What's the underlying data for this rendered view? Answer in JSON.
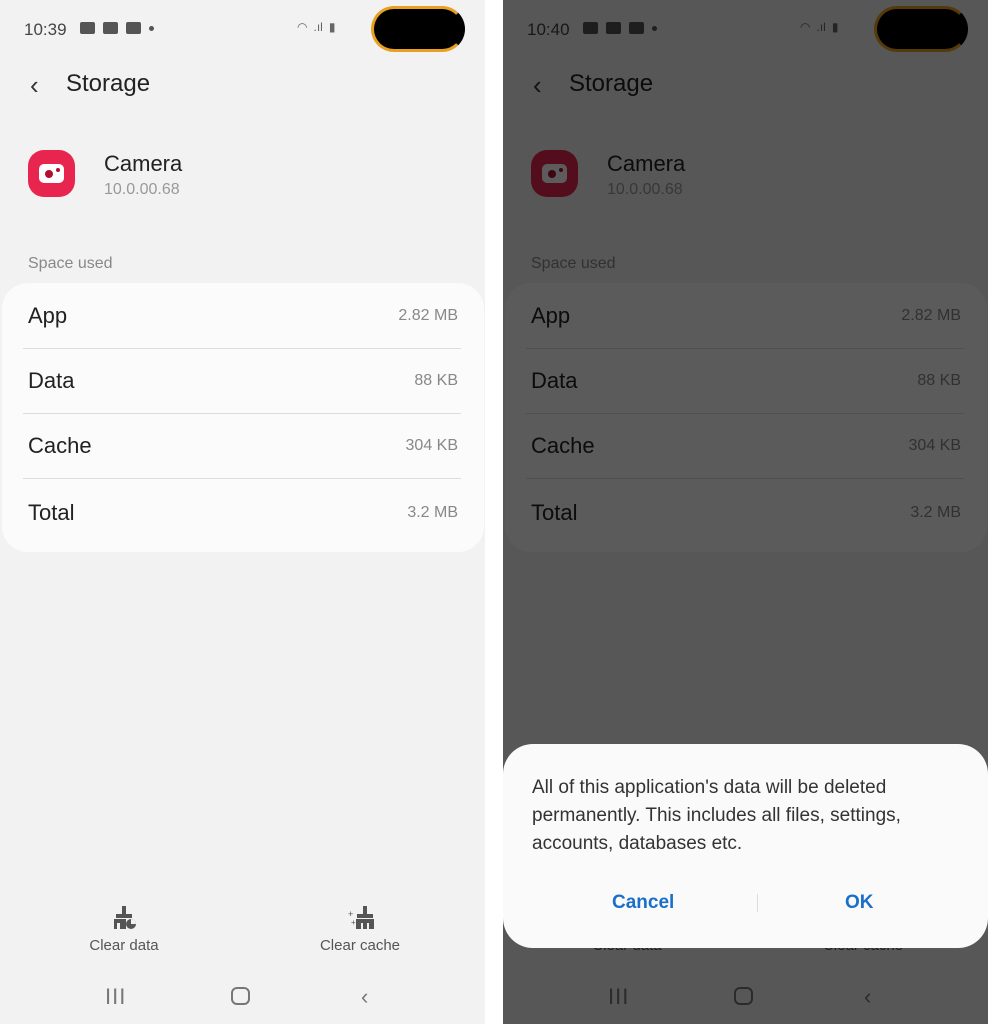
{
  "screens": {
    "left": {
      "status": {
        "time": "10:39",
        "notification_icons": [
          "youtube-icon",
          "gmail-icon",
          "gallery-icon"
        ],
        "system_icons": [
          "wifi-icon",
          "signal-icon",
          "battery-charging-icon"
        ]
      }
    },
    "right": {
      "status": {
        "time": "10:40",
        "notification_icons": [
          "gallery-icon",
          "youtube-icon",
          "gmail-icon"
        ],
        "system_icons": [
          "wifi-icon",
          "signal-icon",
          "battery-charging-icon"
        ]
      },
      "dialog": {
        "message": "All of this application's data will be deleted permanently. This includes all files, settings, accounts, databases etc.",
        "cancel_label": "Cancel",
        "ok_label": "OK"
      }
    }
  },
  "header": {
    "title": "Storage",
    "back_icon": "chevron-left-icon"
  },
  "app": {
    "name": "Camera",
    "version": "10.0.00.68",
    "icon_color": "#e8254e"
  },
  "space_used": {
    "label": "Space used",
    "rows": [
      {
        "label": "App",
        "value": "2.82 MB"
      },
      {
        "label": "Data",
        "value": "88 KB"
      },
      {
        "label": "Cache",
        "value": "304 KB"
      },
      {
        "label": "Total",
        "value": "3.2 MB"
      }
    ]
  },
  "actions": {
    "clear_data": "Clear data",
    "clear_cache": "Clear cache"
  },
  "colors": {
    "accent": "#1a6fc9",
    "background": "#f2f2f2"
  }
}
